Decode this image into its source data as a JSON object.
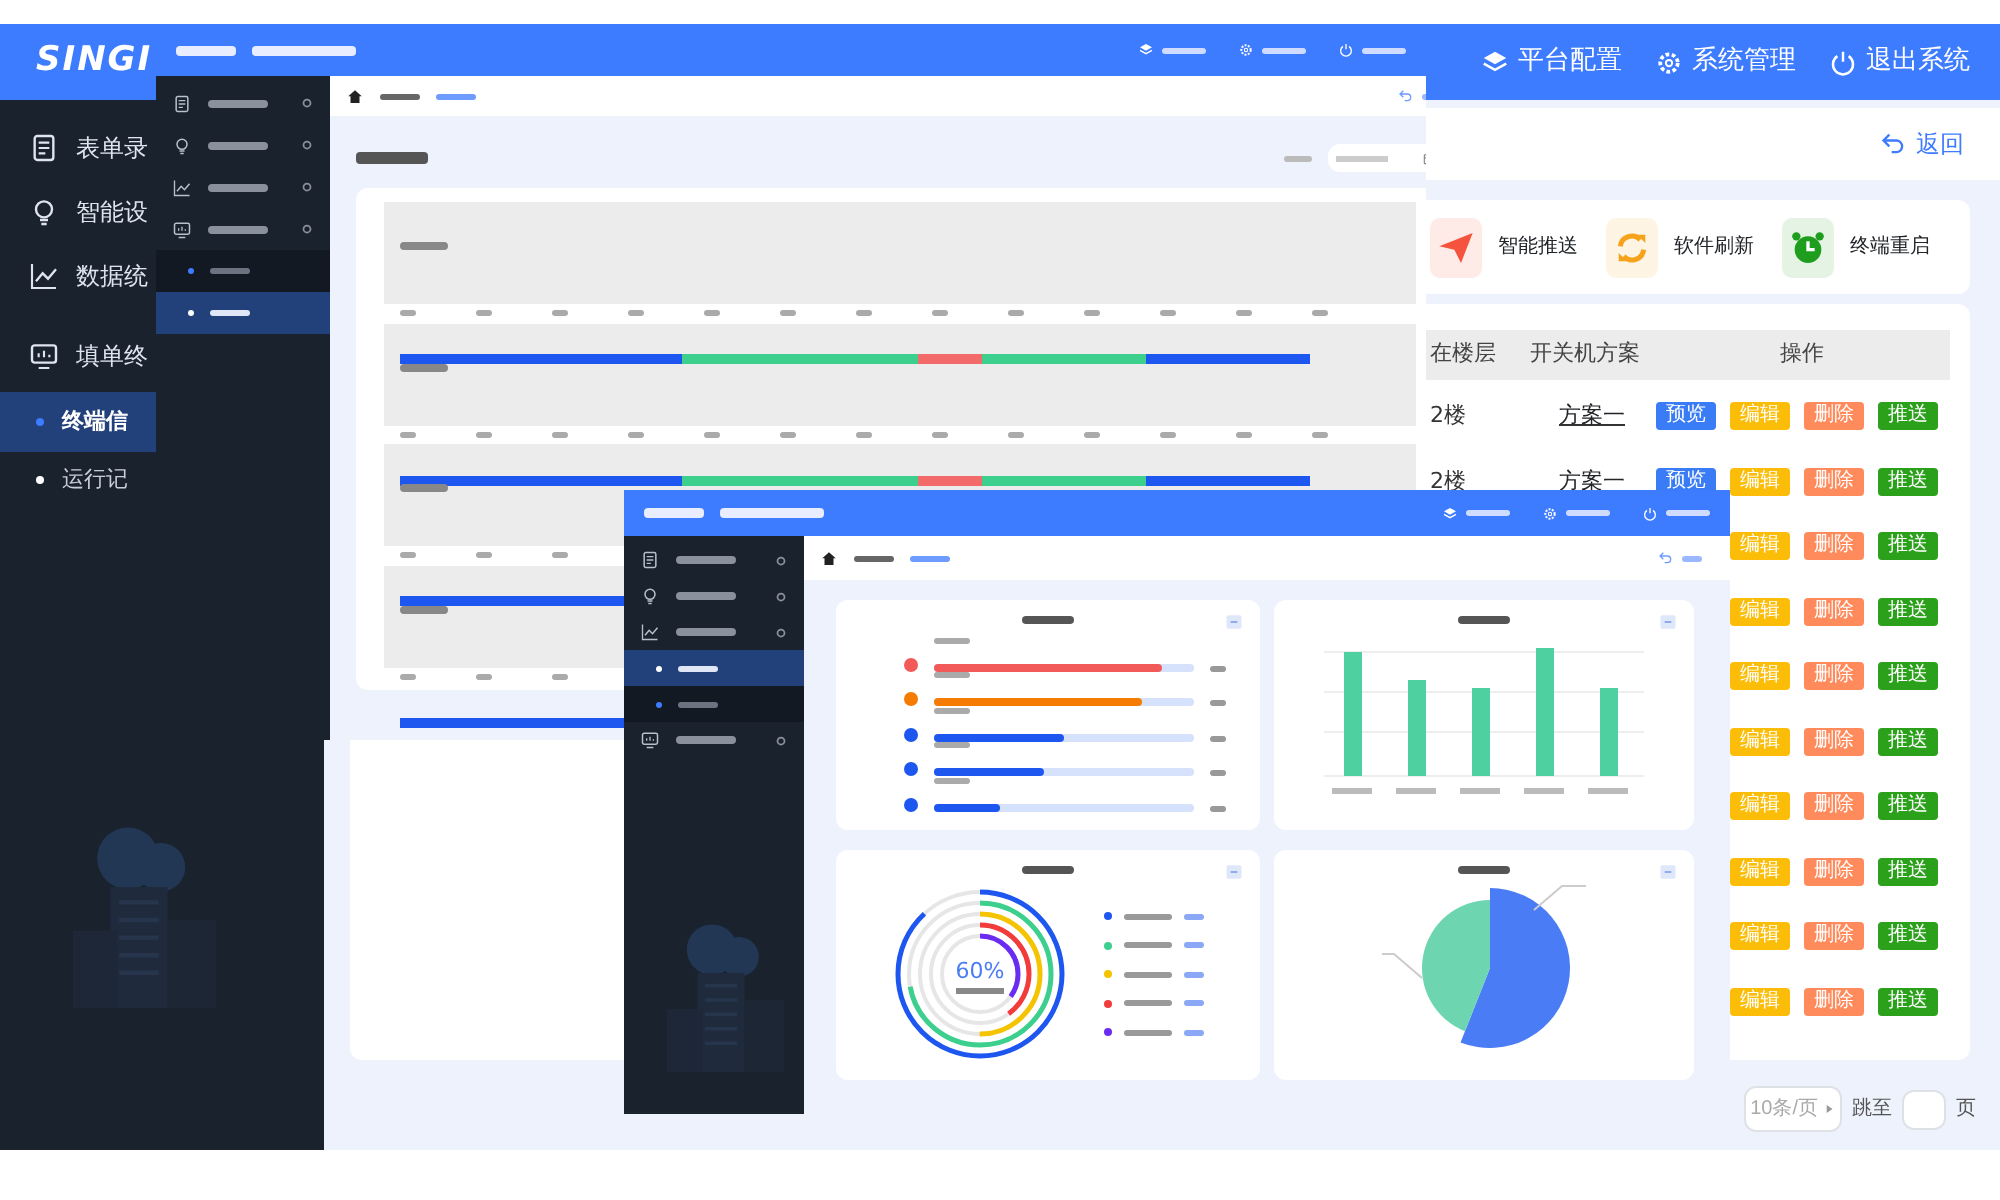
{
  "back_window": {
    "logo": "SINGI",
    "header_actions": [
      {
        "label": "平台配置"
      },
      {
        "label": "系统管理"
      },
      {
        "label": "退出系统"
      }
    ],
    "sidebar": [
      {
        "label": "表单录"
      },
      {
        "label": "智能设"
      },
      {
        "label": "数据统"
      },
      {
        "label": "填单终",
        "children": [
          {
            "label": "终端信",
            "selected": true
          },
          {
            "label": "运行记",
            "selected": false
          }
        ]
      }
    ],
    "back_link": "返回",
    "quick_actions": [
      {
        "label": "智能推送",
        "color": "#f5533d"
      },
      {
        "label": "软件刷新",
        "color": "#f7a21b"
      },
      {
        "label": "终端重启",
        "color": "#1f9d1f"
      }
    ],
    "table": {
      "columns": [
        "在楼层",
        "开关机方案",
        "操作"
      ],
      "rows": [
        {
          "floor": "2楼",
          "plan": "方案一",
          "actions": [
            {
              "label": "预览",
              "kind": "preview"
            },
            {
              "label": "编辑",
              "kind": "edit"
            },
            {
              "label": "删除",
              "kind": "delete"
            },
            {
              "label": "推送",
              "kind": "push"
            }
          ]
        },
        {
          "floor": "2楼",
          "plan": "方案一",
          "actions": [
            {
              "label": "预览",
              "kind": "preview"
            },
            {
              "label": "编辑",
              "kind": "edit"
            },
            {
              "label": "删除",
              "kind": "delete"
            },
            {
              "label": "推送",
              "kind": "push"
            }
          ]
        },
        {
          "actions": [
            {
              "label": "编辑",
              "kind": "edit"
            },
            {
              "label": "删除",
              "kind": "delete"
            },
            {
              "label": "推送",
              "kind": "push"
            }
          ]
        },
        {
          "actions": [
            {
              "label": "编辑",
              "kind": "edit"
            },
            {
              "label": "删除",
              "kind": "delete"
            },
            {
              "label": "推送",
              "kind": "push"
            }
          ]
        },
        {
          "actions": [
            {
              "label": "编辑",
              "kind": "edit"
            },
            {
              "label": "删除",
              "kind": "delete"
            },
            {
              "label": "推送",
              "kind": "push"
            }
          ]
        },
        {
          "actions": [
            {
              "label": "编辑",
              "kind": "edit"
            },
            {
              "label": "删除",
              "kind": "delete"
            },
            {
              "label": "推送",
              "kind": "push"
            }
          ]
        },
        {
          "actions": [
            {
              "label": "编辑",
              "kind": "edit"
            },
            {
              "label": "删除",
              "kind": "delete"
            },
            {
              "label": "推送",
              "kind": "push"
            }
          ]
        },
        {
          "actions": [
            {
              "label": "编辑",
              "kind": "edit"
            },
            {
              "label": "删除",
              "kind": "delete"
            },
            {
              "label": "推送",
              "kind": "push"
            }
          ]
        },
        {
          "actions": [
            {
              "label": "编辑",
              "kind": "edit"
            },
            {
              "label": "删除",
              "kind": "delete"
            },
            {
              "label": "推送",
              "kind": "push"
            }
          ]
        },
        {
          "actions": [
            {
              "label": "编辑",
              "kind": "edit"
            },
            {
              "label": "删除",
              "kind": "delete"
            },
            {
              "label": "推送",
              "kind": "push"
            }
          ]
        }
      ]
    },
    "pagination": {
      "page_size": "10条/页",
      "jump_label": "跳至",
      "unit": "页"
    }
  },
  "middle_window": {
    "sidebar_subitems": [
      {
        "selected": false
      },
      {
        "selected": true
      }
    ]
  },
  "front_window": {
    "sidebar_subitems": [
      {
        "selected": true
      },
      {
        "selected": false
      }
    ],
    "progress": [
      {
        "color": "#f25a5a",
        "level": 0.88
      },
      {
        "color": "#f57c00",
        "level": 0.8
      },
      {
        "color": "#1e56f0",
        "level": 0.5
      },
      {
        "color": "#1e56f0",
        "level": 0.42
      },
      {
        "color": "#1e56f0",
        "level": 0.25
      }
    ],
    "ring_chart": {
      "center": "60%",
      "legend": [
        {
          "color": "#1e56f0"
        },
        {
          "color": "#3ccf8e"
        },
        {
          "color": "#f5c400"
        },
        {
          "color": "#f23b3b"
        },
        {
          "color": "#6a2cf0"
        }
      ]
    },
    "pie": [
      {
        "color": "#4a7df5",
        "level": 0.56
      },
      {
        "color": "#6dd5b0",
        "level": 0.44
      }
    ]
  }
}
